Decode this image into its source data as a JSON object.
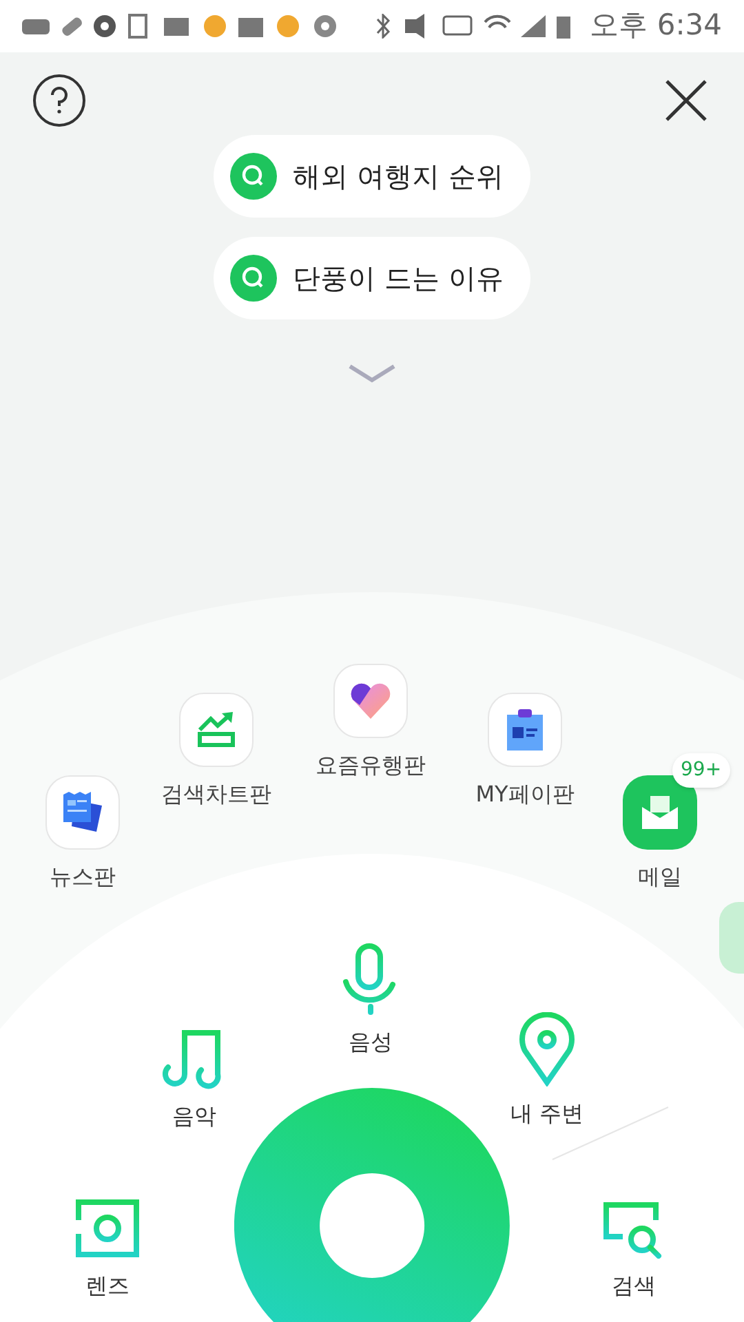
{
  "status_bar": {
    "time": "오후 6:34"
  },
  "suggestions": [
    {
      "text": "해외 여행지 순위"
    },
    {
      "text": "단풍이 드는 이유"
    }
  ],
  "services": [
    {
      "kind": "news",
      "label": "뉴스판"
    },
    {
      "kind": "chart",
      "label": "검색차트판"
    },
    {
      "kind": "trend",
      "label": "요즘유행판"
    },
    {
      "kind": "mypage",
      "label": "MY페이판"
    },
    {
      "kind": "mail",
      "label": "메일",
      "badge": "99+"
    }
  ],
  "actions": [
    {
      "kind": "music",
      "label": "음악"
    },
    {
      "kind": "voice",
      "label": "음성"
    },
    {
      "kind": "place",
      "label": "내 주변"
    },
    {
      "kind": "lens",
      "label": "렌즈"
    },
    {
      "kind": "search",
      "label": "검색"
    }
  ]
}
